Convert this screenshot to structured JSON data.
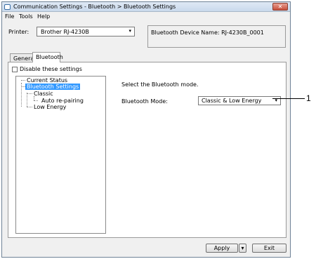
{
  "window": {
    "title": "Communication Settings - Bluetooth > Bluetooth Settings",
    "close_label": "✕"
  },
  "menu": {
    "items": [
      "File",
      "Tools",
      "Help"
    ]
  },
  "printer": {
    "label": "Printer:",
    "selected": "Brother RJ-4230B"
  },
  "device_name": {
    "text": "Bluetooth Device Name: RJ-4230B_0001"
  },
  "tabs": [
    {
      "label": "General",
      "active": false
    },
    {
      "label": "Bluetooth",
      "active": true
    }
  ],
  "disable_checkbox": {
    "label": "Disable these settings",
    "checked": false
  },
  "tree": {
    "items": [
      {
        "label": "Current Status",
        "level": 0,
        "selected": false
      },
      {
        "label": "Bluetooth Settings",
        "level": 0,
        "selected": true
      },
      {
        "label": "Classic",
        "level": 1,
        "selected": false
      },
      {
        "label": "Auto re-pairing",
        "level": 2,
        "selected": false
      },
      {
        "label": "Low Energy",
        "level": 1,
        "selected": false
      }
    ]
  },
  "content": {
    "instruction": "Select the Bluetooth mode.",
    "mode_label": "Bluetooth Mode:",
    "mode_value": "Classic & Low Energy"
  },
  "buttons": {
    "apply": "Apply",
    "exit": "Exit"
  },
  "callout": {
    "number": "1"
  },
  "icons": {
    "dropdown": "▾"
  }
}
